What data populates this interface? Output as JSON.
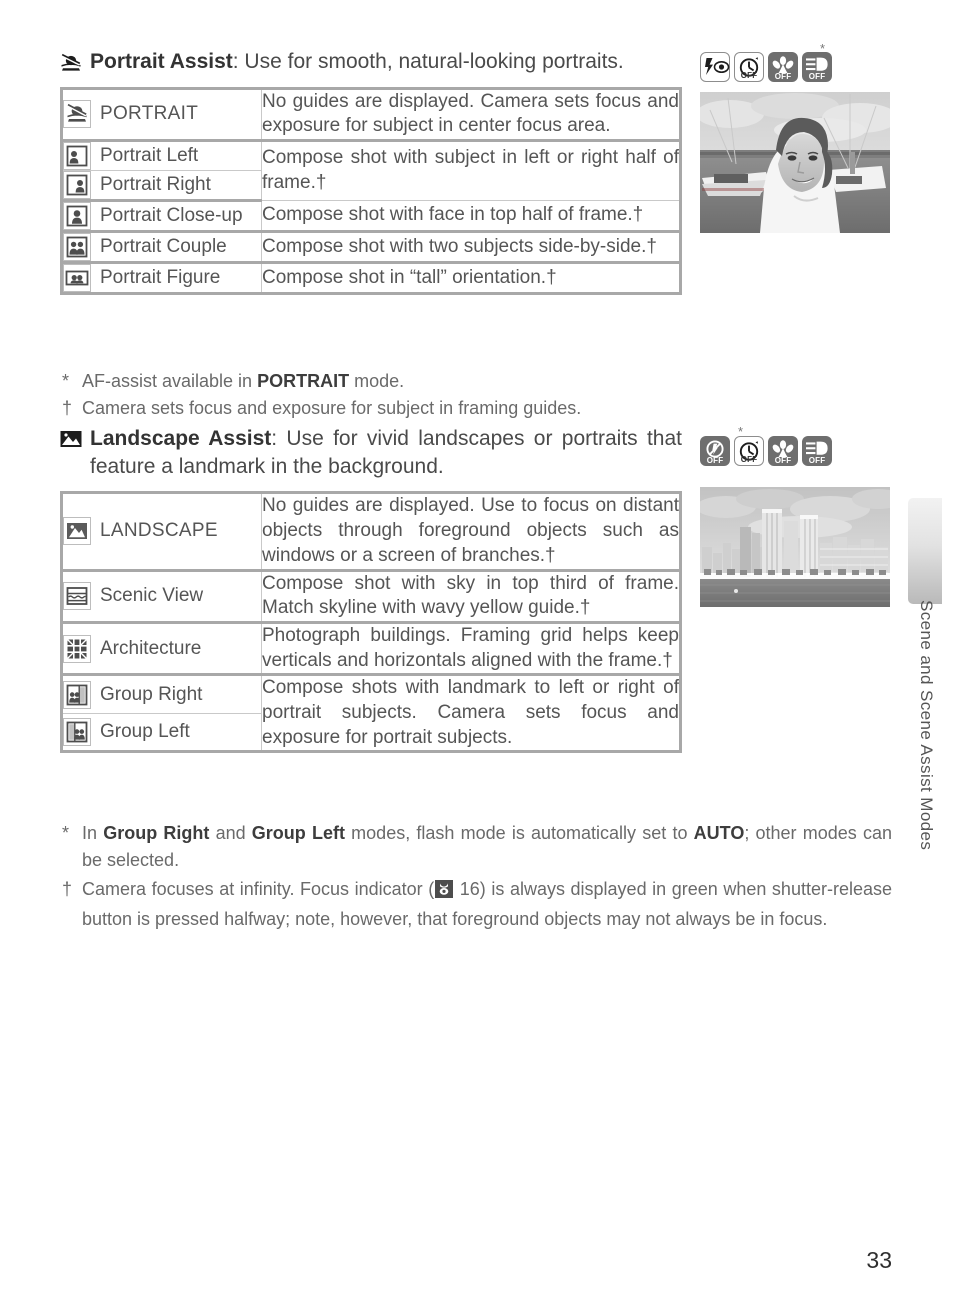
{
  "page": {
    "number": "33",
    "side_tab_label": "Scene and Scene Assist Modes"
  },
  "portrait_section": {
    "icon": "portrait-assist-mode-icon",
    "heading_name": "Portrait Assist",
    "heading_rest": ": Use for smooth, natural-looking portraits.",
    "indicators": [
      {
        "name": "red-eye-reduction-flash-icon",
        "style": "light",
        "off_label": ""
      },
      {
        "name": "self-timer-icon",
        "style": "light",
        "off_label": "OFF"
      },
      {
        "name": "macro-close-up-icon",
        "style": "dark",
        "off_label": "OFF"
      },
      {
        "name": "exposure-compensation-icon",
        "style": "dark",
        "off_label": "OFF"
      }
    ],
    "indicator_star": "*",
    "photo_caption": "portrait photo of woman at marina",
    "table": {
      "rows": [
        {
          "icon": "portrait-mode-icon",
          "label": "PORTRAIT",
          "label_caps": true,
          "description": "No guides are displayed.  Camera sets focus and exposure for subject in center focus area.",
          "group": 1
        },
        {
          "icon": "portrait-left-icon",
          "label": "Portrait Left",
          "label_caps": false,
          "description": "Compose shot with subject in left or right half of frame.†",
          "group": 2
        },
        {
          "icon": "portrait-right-icon",
          "label": "Portrait Right",
          "label_caps": false,
          "description": "",
          "group": 2
        },
        {
          "icon": "portrait-close-up-icon",
          "label": "Portrait Close-up",
          "label_caps": false,
          "description": "Compose shot with face in top half of frame.†",
          "group": 3
        },
        {
          "icon": "portrait-couple-icon",
          "label": "Portrait Couple",
          "label_caps": false,
          "description": "Compose shot with two subjects side-by-side.†",
          "group": 4
        },
        {
          "icon": "portrait-figure-icon",
          "label": "Portrait Figure",
          "label_caps": false,
          "description": "Compose shot in “tall” orientation.†",
          "group": 5
        }
      ]
    },
    "footnotes": [
      {
        "marker": "*",
        "text_before": "AF-assist available in ",
        "bold": "PORTRAIT",
        "text_after": " mode."
      },
      {
        "marker": "†",
        "text_before": "Camera sets focus and exposure for subject in framing guides.",
        "bold": "",
        "text_after": ""
      }
    ]
  },
  "landscape_section": {
    "icon": "landscape-assist-mode-icon",
    "heading_name": "Landscape Assist",
    "heading_rest": ": Use for vivid landscapes or portraits that feature a landmark in the background.",
    "indicators": [
      {
        "name": "flash-off-icon",
        "style": "dark",
        "off_label": "OFF"
      },
      {
        "name": "self-timer-icon",
        "style": "light",
        "off_label": "OFF"
      },
      {
        "name": "macro-close-up-icon",
        "style": "dark",
        "off_label": "OFF"
      },
      {
        "name": "exposure-compensation-icon",
        "style": "dark",
        "off_label": "OFF"
      }
    ],
    "indicator_star": "*",
    "photo_caption": "city skyline over harbor",
    "table": {
      "rows": [
        {
          "icon": "landscape-mode-icon",
          "label": "LANDSCAPE",
          "label_caps": true,
          "description": "No guides are displayed.  Use to focus on distant objects through foreground objects such as windows or a screen of branches.†",
          "group": 1
        },
        {
          "icon": "scenic-view-icon",
          "label": "Scenic View",
          "label_caps": false,
          "description": "Compose shot with sky in top third of frame. Match skyline with wavy yellow guide.†",
          "group": 2
        },
        {
          "icon": "architecture-icon",
          "label": "Architecture",
          "label_caps": false,
          "description": "Photograph buildings.  Framing grid helps keep verticals and horizontals aligned with the frame.†",
          "group": 3
        },
        {
          "icon": "group-right-icon",
          "label": "Group Right",
          "label_caps": false,
          "description": "Compose shots with landmark to left or right of portrait subjects.  Camera sets focus and exposure for portrait subjects.",
          "group": 4
        },
        {
          "icon": "group-left-icon",
          "label": "Group Left",
          "label_caps": false,
          "description": "",
          "group": 4
        }
      ]
    },
    "footnotes": [
      {
        "marker": "*",
        "segments": [
          {
            "t": "In ",
            "b": false
          },
          {
            "t": "Group Right",
            "b": true
          },
          {
            "t": " and ",
            "b": false
          },
          {
            "t": "Group Left",
            "b": true
          },
          {
            "t": " modes, flash mode is automatically set to ",
            "b": false
          },
          {
            "t": "AUTO",
            "b": true
          },
          {
            "t": "; other modes can be selected.",
            "b": false
          }
        ]
      },
      {
        "marker": "†",
        "segments": [
          {
            "t": "Camera focuses at infinity.  Focus indicator (",
            "b": false
          },
          {
            "t": "ICON",
            "b": false
          },
          {
            "t": " 16) is always displayed in green when shutter-release button is pressed halfway; note, however, that foreground objects may not always be in focus.",
            "b": false
          }
        ],
        "inline_icon": "focus-indicator-icon"
      }
    ]
  }
}
